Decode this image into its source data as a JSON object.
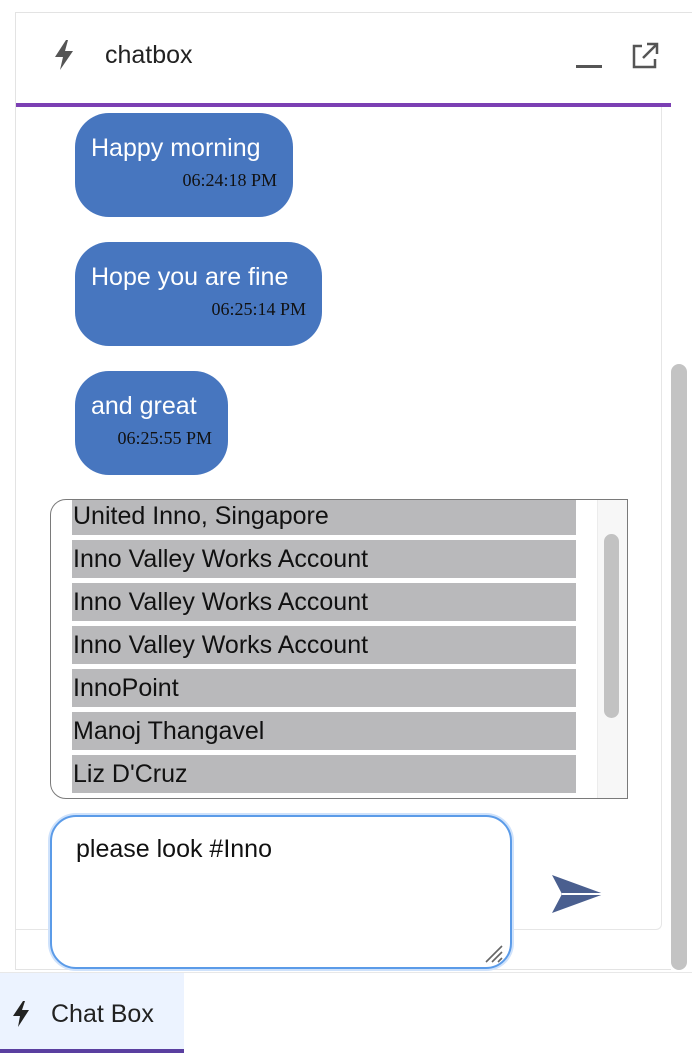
{
  "header": {
    "title": "chatbox",
    "icons": {
      "app": "lightning-bolt-icon",
      "minimize": "minimize-icon",
      "popout": "external-link-icon"
    }
  },
  "messages": [
    {
      "text": "Happy morning",
      "time": "06:24:18 PM"
    },
    {
      "text": "Hope you are fine",
      "time": "06:25:14 PM"
    },
    {
      "text": "and great",
      "time": "06:25:55 PM"
    }
  ],
  "suggestions": [
    "United Inno, Singapore",
    "Inno Valley Works Account",
    "Inno Valley Works Account",
    "Inno Valley Works Account",
    "InnoPoint",
    "Manoj Thangavel",
    "Liz D'Cruz"
  ],
  "composer": {
    "value": "please look #Inno"
  },
  "bottom_tab": {
    "label": "Chat Box"
  },
  "colors": {
    "accent": "#7b3fb3",
    "bubble": "#4776bf",
    "suggestion_bg": "#b9b9bb",
    "send_icon": "#4a5f8f",
    "composer_border": "#5b9be8"
  }
}
